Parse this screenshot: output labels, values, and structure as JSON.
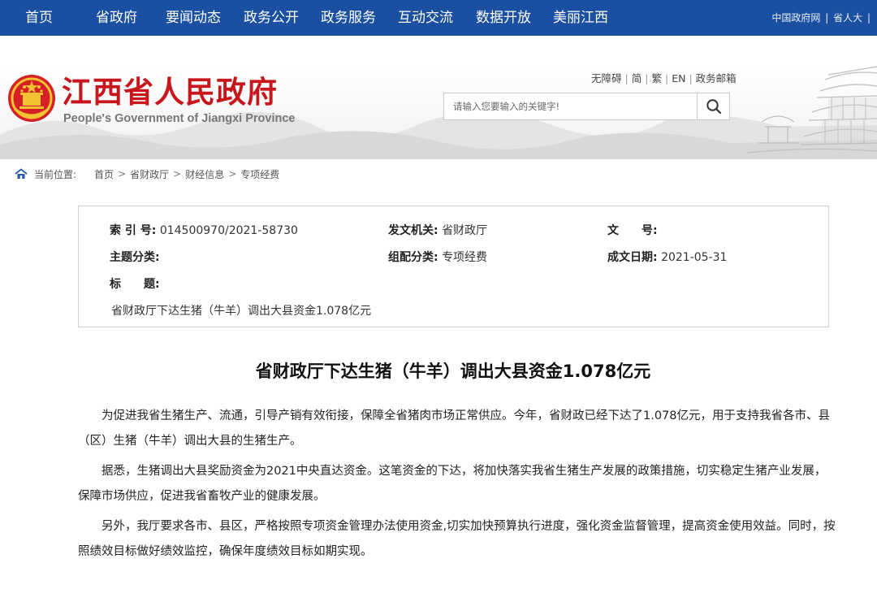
{
  "nav": {
    "items": [
      "首页",
      "省政府",
      "要闻动态",
      "政务公开",
      "政务服务",
      "互动交流",
      "数据开放",
      "美丽江西"
    ],
    "right_links": [
      "中国政府网",
      "省人大"
    ]
  },
  "header": {
    "logo_cn": "江西省人民政府",
    "logo_en": "People's Government of Jiangxi Province",
    "util_links": [
      "无障碍",
      "简",
      "繁",
      "EN",
      "政务邮箱"
    ],
    "search_placeholder": "请输入您要输入的关键字!"
  },
  "breadcrumb": {
    "label": "当前位置:",
    "items": [
      "首页",
      "省财政厅",
      "财经信息",
      "专项经费"
    ]
  },
  "meta": {
    "index_key": "索 引 号:",
    "index_val": "014500970/2021-58730",
    "issuer_key": "发文机关:",
    "issuer_val": "省财政厅",
    "docno_key": "文　　号:",
    "docno_val": "",
    "theme_key": "主题分类:",
    "theme_val": "",
    "category_key": "组配分类:",
    "category_val": "专项经费",
    "date_key": "成文日期:",
    "date_val": "2021-05-31",
    "title_key": "标　　题:",
    "title_val": "省财政厅下达生猪（牛羊）调出大县资金1.078亿元"
  },
  "article": {
    "title": "省财政厅下达生猪（牛羊）调出大县资金1.078亿元",
    "paragraphs": [
      "为促进我省生猪生产、流通，引导产销有效衔接，保障全省猪肉市场正常供应。今年，省财政已经下达了1.078亿元，用于支持我省各市、县（区）生猪（牛羊）调出大县的生猪生产。",
      "据悉，生猪调出大县奖励资金为2021中央直达资金。这笔资金的下达，将加快落实我省生猪生产发展的政策措施，切实稳定生猪产业发展，保障市场供应，促进我省畜牧产业的健康发展。",
      "另外，我厅要求各市、县区，严格按照专项资金管理办法使用资金,切实加快预算执行进度，强化资金监督管理，提高资金使用效益。同时，按照绩效目标做好绩效监控，确保年度绩效目标如期实现。"
    ]
  },
  "colors": {
    "nav_bg": "#1a4fa1",
    "logo_red": "#c8161d"
  }
}
